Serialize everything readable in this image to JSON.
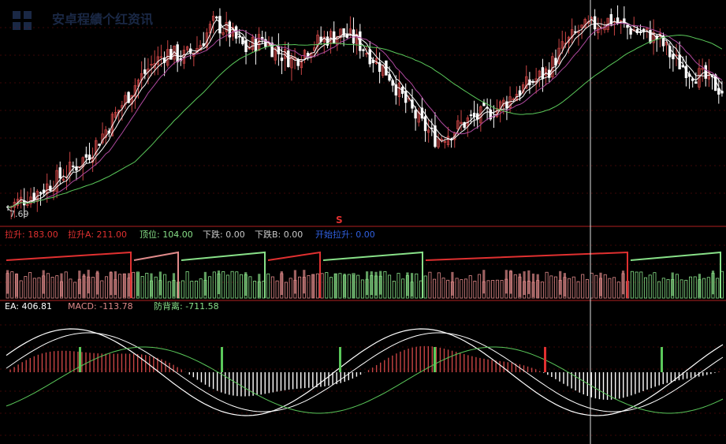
{
  "watermark": "安卓程績个红资讯",
  "colors": {
    "background": "#000000",
    "up": "#c84444",
    "down": "#ffffff",
    "green": "#5ac85a",
    "magenta": "#b04aa0",
    "white": "#ffffff",
    "red": "#e03030",
    "pink": "#e08a8a",
    "lightgreen": "#88e088",
    "blue": "#3060e0",
    "grid": "#7a1010",
    "label": "#c8c8c8"
  },
  "chart_data": [
    {
      "type": "candlestick",
      "title": "",
      "min_price_label": "7.69",
      "trend": {
        "close": [
          7.7,
          8.0,
          8.3,
          8.7,
          9.1,
          9.6,
          10.4,
          11.3,
          12.2,
          12.9,
          13.4,
          13.2,
          13.6,
          14.5,
          14.1,
          13.5,
          13.9,
          13.4,
          13.1,
          13.6,
          13.9,
          14.1,
          13.8,
          13.2,
          12.6,
          11.6,
          10.8,
          10.2,
          10.5,
          10.9,
          11.1,
          11.4,
          11.9,
          12.3,
          12.7,
          13.6,
          14.2,
          14.4,
          14.6,
          14.3,
          14.1,
          13.9,
          13.1,
          12.7,
          12.4,
          12.0
        ]
      }
    },
    {
      "type": "bar",
      "title": "",
      "legend": [
        {
          "label": "拉升",
          "value": "183.00",
          "color": "#e03030"
        },
        {
          "label": "拉升A",
          "value": "211.00",
          "color": "#e03030"
        },
        {
          "label": "顶位",
          "value": "104.00",
          "color": "#88e088"
        },
        {
          "label": "下跌",
          "value": "0.00",
          "color": "#c8c8c8"
        },
        {
          "label": "下跌B",
          "value": "0.00",
          "color": "#c8c8c8"
        },
        {
          "label": "开始拉升",
          "value": "0.00",
          "color": "#3060e0"
        }
      ],
      "marker": "S"
    },
    {
      "type": "line",
      "title": "",
      "legend": [
        {
          "label": "EA",
          "value": "406.81",
          "color": "#ffffff"
        },
        {
          "label": "MACD",
          "value": "-113.78",
          "color": "#e08a8a"
        },
        {
          "label": "防背离",
          "value": "-711.58",
          "color": "#88e088"
        }
      ]
    }
  ]
}
